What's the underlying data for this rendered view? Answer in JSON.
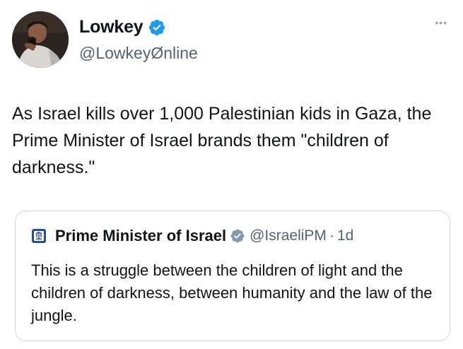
{
  "tweet": {
    "author": {
      "name": "Lowkey",
      "handle": "@LowkeyØnline",
      "verified": true
    },
    "menu_icon": "more-dots-icon",
    "text": "As Israel kills over 1,000 Palestinian kids in Gaza, the Prime Minister of Israel brands them \"children of darkness.\"",
    "quote": {
      "author_name": "Prime Minister of Israel",
      "handle": "@IsraeliPM",
      "separator": "·",
      "time": "1d",
      "text": "This is a struggle between the children of light and the children of darkness, between humanity and the law of the jungle."
    }
  },
  "colors": {
    "verified_blue": "#1d9bf0",
    "gov_check_gray": "#829aab",
    "text_primary": "#0f1419",
    "text_secondary": "#536471"
  }
}
